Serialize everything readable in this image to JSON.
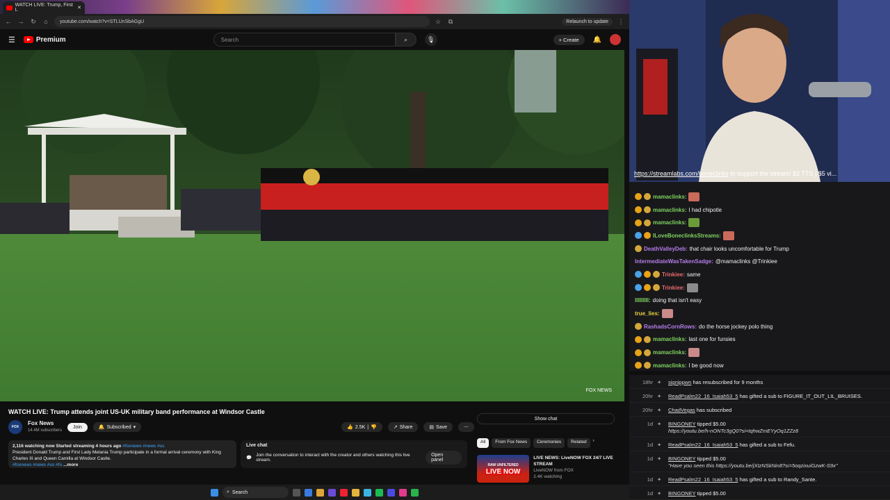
{
  "browser": {
    "tab_title": "WATCH LIVE: Trump, First L",
    "url": "youtube.com/watch?v=STLUnSbAGgU",
    "relaunch": "Relaunch to update"
  },
  "youtube": {
    "brand": "Premium",
    "search_placeholder": "Search",
    "create_label": "Create"
  },
  "video": {
    "title": "WATCH LIVE: Trump attends joint US-UK military band performance at Windsor Castle",
    "watermark": "FOX NEWS"
  },
  "channel": {
    "name": "Fox News",
    "subscribers": "14.4M subscribers",
    "join": "Join",
    "subscribed": "Subscribed"
  },
  "actions": {
    "likes": "2.5K",
    "share": "Share",
    "save": "Save"
  },
  "description": {
    "stats": "2,116 watching now  Started streaming 4 hours ago",
    "tags": "#foxnews #news #us",
    "text": "President Donald Trump and First Lady Melania Trump participate in a formal arrival ceremony with King Charles III and Queen Camilla at Windsor Castle.",
    "tags2": "#foxnews #news #us #fo",
    "more": "...more"
  },
  "livechat": {
    "title": "Live chat",
    "text": "Join the conversation to interact with the creator and others watching this live stream.",
    "open": "Open panel"
  },
  "show_chat": "Show chat",
  "chips": [
    "All",
    "From Fox News",
    "Ceremonies",
    "Related"
  ],
  "recommendation": {
    "thumb_text": "LIVE NOW",
    "thumb_top": "RAW UNFILTERED",
    "title": "LIVE NEWS: LiveNOW FOX 24/7 LIVE STREAM",
    "channel": "LiveNOW from FOX",
    "views": "2.4K watching"
  },
  "taskbar": {
    "search": "Search"
  },
  "stream_overlay": {
    "link": "https://streamlabs.com/boneclinks",
    "text": " to support the stream! $2 TTS | $5 vi..."
  },
  "chat": [
    {
      "user": "mamaclinks:",
      "color": "#7fd35f",
      "text": "",
      "emote": "#c96a5a",
      "badges": [
        "#e8a317",
        "#d4a73a"
      ]
    },
    {
      "user": "mamaclinks:",
      "color": "#7fd35f",
      "text": "I had chipotle",
      "emote": "",
      "badges": [
        "#e8a317",
        "#d4a73a"
      ]
    },
    {
      "user": "mamaclinks:",
      "color": "#7fd35f",
      "text": "",
      "emote": "#6a9a3a",
      "badges": [
        "#e8a317",
        "#d4a73a"
      ]
    },
    {
      "user": "ILoveBoneclinksStreams:",
      "color": "#7fd35f",
      "text": "",
      "emote": "#c96a5a",
      "badges": [
        "#4aa3e8",
        "#e8a317"
      ]
    },
    {
      "user": "DeathValleyDeb:",
      "color": "#b57de8",
      "text": "that chair looks uncomfortable for Trump",
      "emote": "",
      "badges": [
        "#d4a73a"
      ]
    },
    {
      "user": "IntermediateWasTakenSadge:",
      "color": "#b57de8",
      "text": "@mamaclinks @Trinkiee",
      "emote": "",
      "badges": []
    },
    {
      "user": "Trinkiee:",
      "color": "#e86a6a",
      "text": "same",
      "emote": "",
      "badges": [
        "#4aa3e8",
        "#e8a317",
        "#d4a73a"
      ]
    },
    {
      "user": "Trinkiee:",
      "color": "#e86a6a",
      "text": "",
      "emote": "#8a8a8a",
      "badges": [
        "#4aa3e8",
        "#e8a317",
        "#d4a73a"
      ]
    },
    {
      "user": "IIIIIIIII:",
      "color": "#7fd35f",
      "text": "doing that isn't easy",
      "emote": "",
      "badges": []
    },
    {
      "user": "true_lies:",
      "color": "#e8d23a",
      "text": "",
      "emote": "#c98a8a",
      "badges": []
    },
    {
      "user": "RashadsCornRows:",
      "color": "#b57de8",
      "text": "do the horse jockey polo thing",
      "emote": "",
      "badges": [
        "#d4a73a"
      ]
    },
    {
      "user": "mamaclinks:",
      "color": "#7fd35f",
      "text": "last one for funsies",
      "emote": "",
      "badges": [
        "#e8a317",
        "#d4a73a"
      ]
    },
    {
      "user": "mamaclinks:",
      "color": "#7fd35f",
      "text": "",
      "emote": "#c98a8a",
      "badges": [
        "#e8a317",
        "#d4a73a"
      ]
    },
    {
      "user": "mamaclinks:",
      "color": "#7fd35f",
      "text": "I be good now",
      "emote": "",
      "badges": [
        "#e8a317",
        "#d4a73a"
      ]
    }
  ],
  "events": [
    {
      "time": "18hr",
      "user": "signippwn",
      "text": " has resubscribed for 9 months",
      "sub": ""
    },
    {
      "time": "20hr",
      "user": "ReadPsalm22_16_Isaiah53_5",
      "text": " has gifted a sub to FIGURE_IT_OUT_LIL_BRUISES.",
      "sub": ""
    },
    {
      "time": "20hr",
      "user": "ChadVegas",
      "text": " has subscribed",
      "sub": ""
    },
    {
      "time": "1d",
      "user": "BINGONEY",
      "text": " tipped $5.00",
      "sub": "https://youtu.be/h-nONTc3gQ0?si=tqhwZmEYyOq1ZZz8"
    },
    {
      "time": "1d",
      "user": "ReadPsalm22_16_Isaiah53_5",
      "text": " has gifted a sub to Fefu.",
      "sub": ""
    },
    {
      "time": "1d",
      "user": "BINGONEY",
      "text": " tipped $5.00",
      "sub": "\"Have you seen this https://youtu.be/jXIzNSkNin8?si=5oqzixuiGzwK-S9x\""
    },
    {
      "time": "1d",
      "user": "ReadPsalm22_16_Isaiah53_5",
      "text": " has gifted a sub to Randy_Sante.",
      "sub": ""
    },
    {
      "time": "1d",
      "user": "BINGONEY",
      "text": " tipped $5.00",
      "sub": ""
    }
  ]
}
